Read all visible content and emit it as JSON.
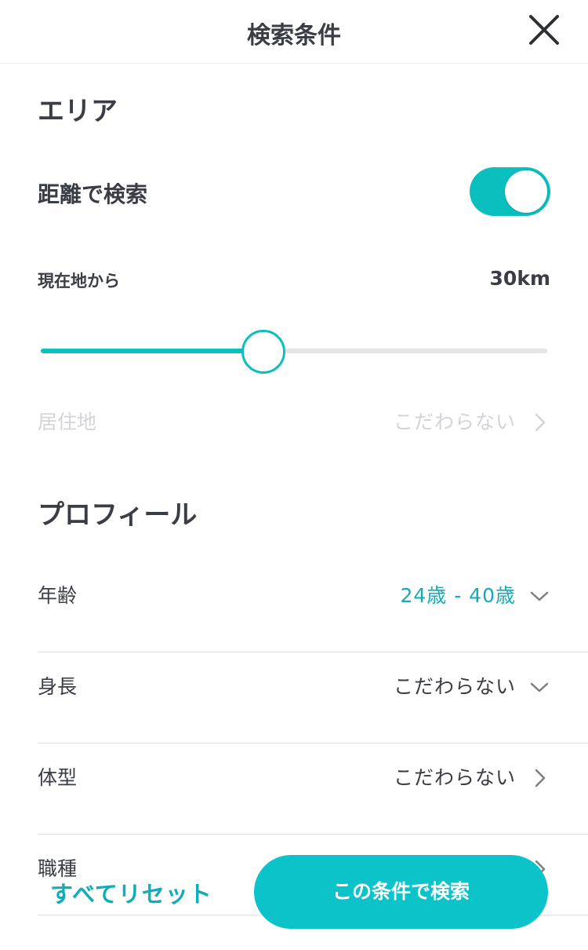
{
  "header": {
    "title": "検索条件",
    "close_icon": "close-icon"
  },
  "area": {
    "section_title": "エリア",
    "distance_search_label": "距離で検索",
    "distance_toggle_on": true,
    "from_current_label": "現在地から",
    "distance_value": "30km",
    "slider_level": 0.44,
    "residence_label": "居住地",
    "residence_value": "こだわらない"
  },
  "profile": {
    "section_title": "プロフィール",
    "rows": [
      {
        "label": "年齢",
        "value": "24歳 - 40歳",
        "icon": "chevron-down-icon"
      },
      {
        "label": "身長",
        "value": "こだわらない",
        "icon": "chevron-down-icon"
      },
      {
        "label": "体型",
        "value": "こだわらない",
        "icon": "chevron-right-icon"
      },
      {
        "label": "職種",
        "value": "",
        "icon": "chevron-right-icon"
      }
    ]
  },
  "footer": {
    "reset_label": "すべてリセット",
    "search_label": "この条件で検索"
  },
  "colors": {
    "accent": "#0bbfbf",
    "accent_text": "#12acb8",
    "text": "#3a3d45",
    "disabled": "#d2d4d8"
  }
}
